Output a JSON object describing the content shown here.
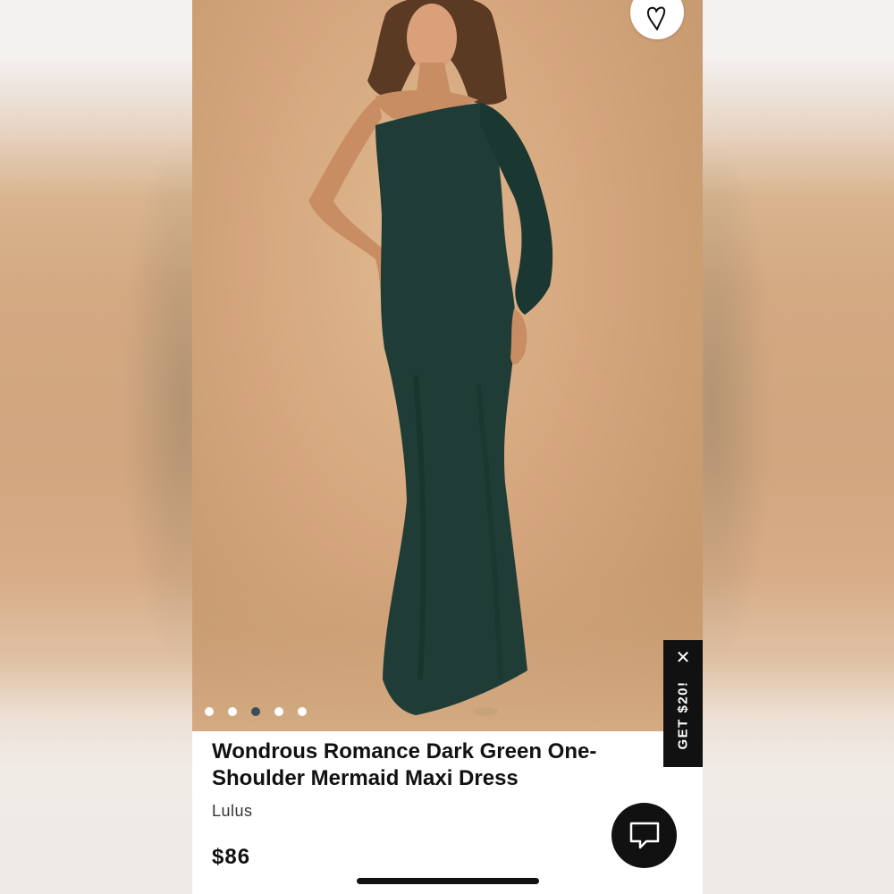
{
  "product": {
    "title": "Wondrous Romance Dark Green One-Shoulder Mermaid Maxi Dress",
    "brand": "Lulus",
    "price": "$86"
  },
  "gallery": {
    "dot_count": 5,
    "active_index": 2
  },
  "promo": {
    "label": "GET $20!",
    "close_symbol": "✕"
  },
  "icons": {
    "wishlist": "heart-icon",
    "chat": "chat-bubble-icon"
  },
  "colors": {
    "dress": "#1f3d36",
    "background": "#d5a67d",
    "dot_active": "#3a4d5a",
    "promo_bg": "#111111"
  }
}
